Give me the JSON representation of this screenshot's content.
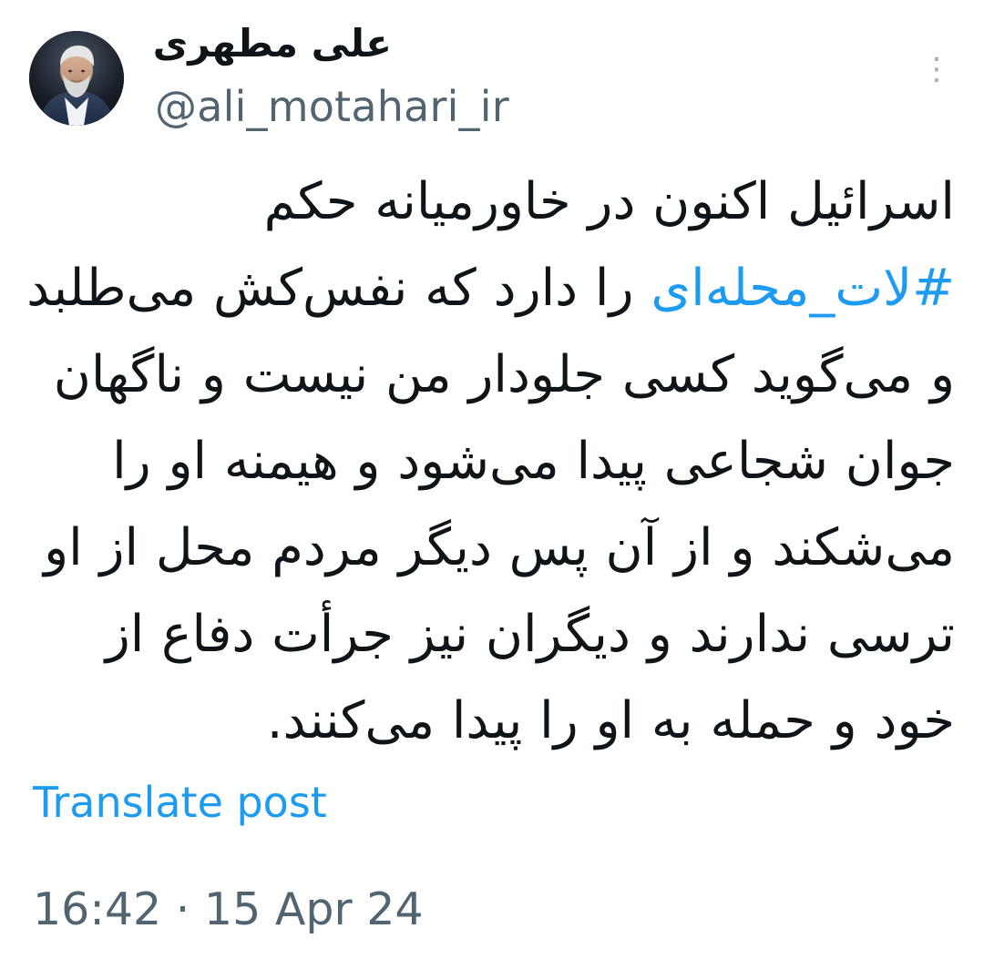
{
  "header": {
    "display_name": "علی مطهری",
    "handle": "@ali_motahari_ir",
    "more_icon": "⋮"
  },
  "tweet": {
    "line1": "اسرائیل اکنون در خاورمیانه حکم",
    "hashtag": "#لات_محله‌ای",
    "line2_rest": " را دارد که نفس‌کش می‌طلبد",
    "line3": "و می‌گوید کسی جلودار من نیست و ناگهان",
    "line4": "جوان شجاعی پیدا می‌شود و هیمنه او را",
    "line5": "می‌شکند و از آن پس دیگر مردم محل از او",
    "line6": "ترسی ندارند و دیگران نیز جرأت دفاع از",
    "line7": "خود و حمله به او را پیدا می‌کنند."
  },
  "actions": {
    "translate_label": "Translate post"
  },
  "meta": {
    "timestamp": "16:42 · 15 Apr 24"
  },
  "colors": {
    "text_primary": "#0f1419",
    "text_secondary": "#536471",
    "accent": "#1d9bf0",
    "background": "#ffffff"
  }
}
